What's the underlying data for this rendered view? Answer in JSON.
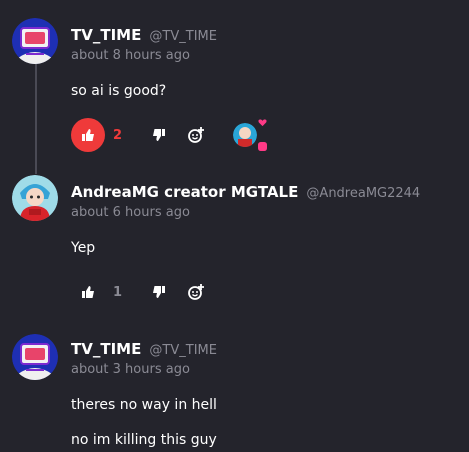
{
  "comments": [
    {
      "author": "TV_TIME",
      "handle": "@TV_TIME",
      "time": "about 8 hours ago",
      "lines": [
        "so ai is good?"
      ],
      "likes": "2",
      "liked": true,
      "avatar_icon": "tv-character-avatar"
    },
    {
      "author": "AndreaMG creator MGTALE",
      "handle": "@AndreaMG2244",
      "time": "about 6 hours ago",
      "lines": [
        "Yep"
      ],
      "likes": "1",
      "liked": false,
      "avatar_icon": "red-hoodie-character-avatar"
    },
    {
      "author": "TV_TIME",
      "handle": "@TV_TIME",
      "time": "about 3 hours ago",
      "lines": [
        "theres no way in hell",
        "no im killing this guy"
      ],
      "avatar_icon": "tv-character-avatar"
    }
  ],
  "icons": {
    "like": "thumbs-up-icon",
    "dislike": "thumbs-down-icon",
    "react": "add-emoji-icon",
    "creator_heart": "heart-icon"
  },
  "colors": {
    "background": "#24242c",
    "accent": "#ef3a3a",
    "muted_text": "#8a8a94",
    "heart": "#ff3a86"
  }
}
